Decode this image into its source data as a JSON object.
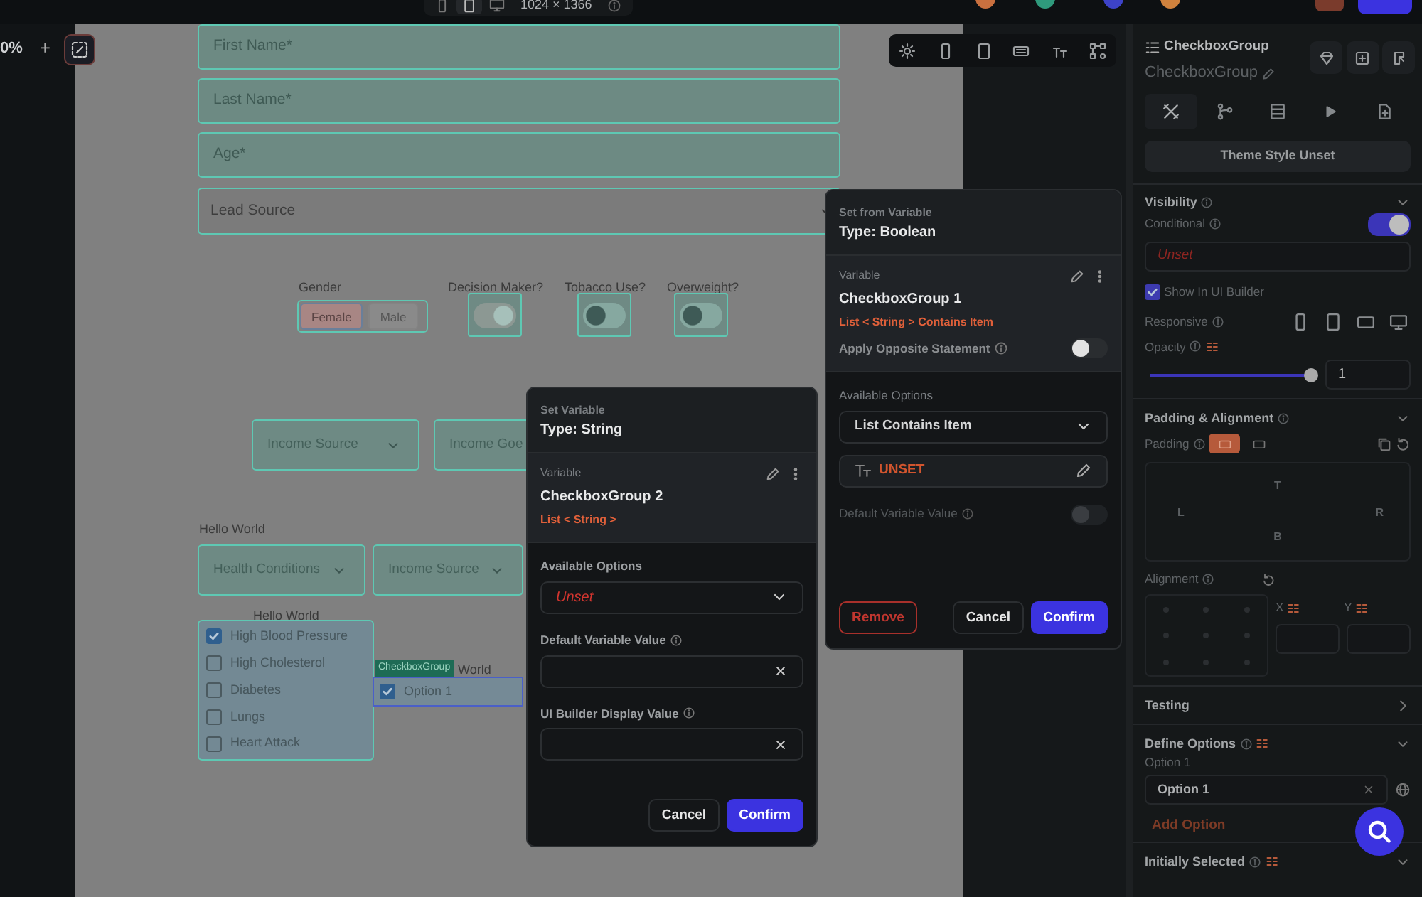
{
  "top_bar": {
    "zoom": "0%",
    "zoom_in": "+",
    "canvas_size": "1024 × 1366"
  },
  "canvas": {
    "text_fields": [
      {
        "placeholder": "First Name*"
      },
      {
        "placeholder": "Last Name*"
      },
      {
        "placeholder": "Age*"
      }
    ],
    "lead_source": {
      "placeholder": "Lead Source"
    },
    "gender": {
      "label": "Gender",
      "options": [
        {
          "label": "Female",
          "selected": true
        },
        {
          "label": "Male",
          "selected": false
        }
      ]
    },
    "switches": [
      {
        "label": "Decision Maker?",
        "on": true
      },
      {
        "label": "Tobacco Use?",
        "on": false
      },
      {
        "label": "Overweight?",
        "on": false
      }
    ],
    "dropdowns": [
      {
        "label": "Income Source",
        "clipped": false
      },
      {
        "label": "Income Goe",
        "clipped": true
      },
      {
        "label": "Health Conditions",
        "clipped": false
      },
      {
        "label": "Income Source",
        "clipped": false
      }
    ],
    "captions": [
      "Hello World",
      "Hello World"
    ],
    "checkbox_list": [
      {
        "label": "High Blood Pressure",
        "checked": true
      },
      {
        "label": "High Cholesterol",
        "checked": false
      },
      {
        "label": "Diabetes",
        "checked": false
      },
      {
        "label": "Lungs",
        "checked": false
      },
      {
        "label": "Heart Attack",
        "checked": false
      }
    ],
    "selected_widget": {
      "tag": "CheckboxGroup",
      "caption": "World",
      "options": [
        {
          "label": "Option 1",
          "checked": true
        }
      ]
    }
  },
  "set_variable_popup": {
    "heading": "Set Variable",
    "type": "Type: String",
    "variable_label": "Variable",
    "variable_name": "CheckboxGroup 2",
    "variable_type": "List < String >",
    "options_label": "Available Options",
    "options_value": "Unset",
    "default_label": "Default Variable Value",
    "display_label": "UI Builder Display Value",
    "buttons": [
      {
        "label": "Cancel",
        "kind": "secondary"
      },
      {
        "label": "Confirm",
        "kind": "primary"
      }
    ]
  },
  "set_from_variable_popup": {
    "heading": "Set from Variable",
    "type": "Type: Boolean",
    "variable_label": "Variable",
    "variable_name": "CheckboxGroup 1",
    "variable_type": "List < String > Contains Item",
    "opposite": {
      "label": "Apply Opposite Statement",
      "on": false,
      "disabled": false
    },
    "options_label": "Available Options",
    "options_value": "List Contains Item",
    "item_value": "UNSET",
    "default": {
      "label": "Default Variable Value",
      "on": false,
      "disabled": true
    },
    "buttons": [
      {
        "label": "Remove",
        "kind": "danger"
      },
      {
        "label": "Cancel",
        "kind": "secondary"
      },
      {
        "label": "Confirm",
        "kind": "primary"
      }
    ]
  },
  "properties_panel": {
    "widget_type": "CheckboxGroup",
    "widget_name": "CheckboxGroup",
    "tabs": [
      {
        "selected": true
      },
      {
        "selected": false
      },
      {
        "selected": false
      },
      {
        "selected": false
      },
      {
        "selected": false
      }
    ],
    "theme_button": "Theme Style Unset",
    "visibility": {
      "title": "Visibility",
      "expanded": true,
      "conditional_label": "Conditional",
      "conditional_on": true,
      "condition_value": "Unset",
      "show_in_builder": {
        "label": "Show In UI Builder",
        "checked": true
      },
      "responsive_label": "Responsive",
      "opacity_label": "Opacity",
      "opacity": {
        "level": 1
      },
      "opacity_value": "1"
    },
    "padding": {
      "title": "Padding & Alignment",
      "expanded": true,
      "padding_label": "Padding",
      "modes": [
        {
          "selected": true
        },
        {
          "selected": false
        }
      ],
      "sides": {
        "top": "T",
        "left": "L",
        "right": "R",
        "bottom": "B"
      },
      "alignment_label": "Alignment",
      "x_label": "X",
      "y_label": "Y"
    },
    "testing": {
      "title": "Testing",
      "expanded": false
    },
    "define_options": {
      "title": "Define Options",
      "expanded": true,
      "options": [
        {
          "label": "Option 1",
          "value": "Option 1"
        }
      ],
      "add_button": "Add Option"
    },
    "initially_selected": {
      "title": "Initially Selected",
      "expanded": true
    }
  }
}
